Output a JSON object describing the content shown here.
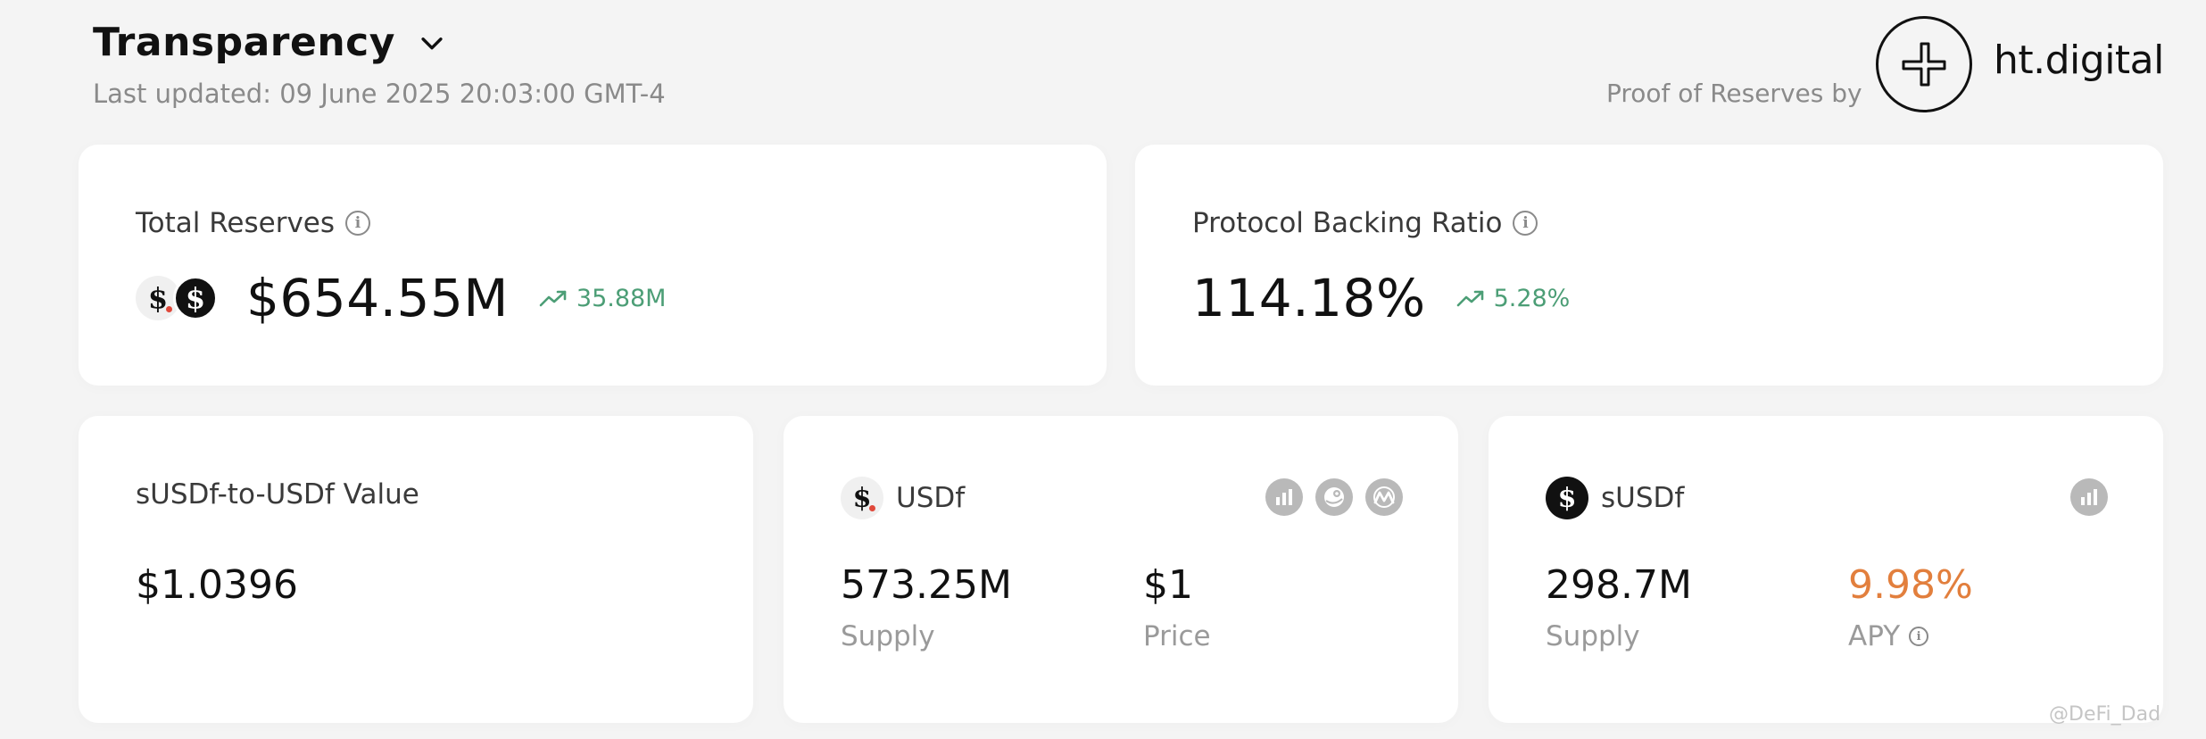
{
  "header": {
    "title": "Transparency",
    "last_updated": "Last updated: 09 June 2025 20:03:00 GMT-4",
    "por_label": "Proof of Reserves by",
    "brand_name": "ht.digital"
  },
  "total_reserves": {
    "label": "Total Reserves",
    "value": "$654.55M",
    "change": "35.88M"
  },
  "backing_ratio": {
    "label": "Protocol Backing Ratio",
    "value": "114.18%",
    "change": "5.28%"
  },
  "susdf_value": {
    "label": "sUSDf-to-USDf Value",
    "value": "$1.0396"
  },
  "usdf": {
    "name": "USDf",
    "supply_value": "573.25M",
    "supply_label": "Supply",
    "price_value": "$1",
    "price_label": "Price",
    "links": [
      "chart-icon",
      "gecko-icon",
      "coinmarketcap-icon"
    ]
  },
  "susdf": {
    "name": "sUSDf",
    "supply_value": "298.7M",
    "supply_label": "Supply",
    "apy_value": "9.98%",
    "apy_label": "APY",
    "links": [
      "chart-icon"
    ]
  },
  "watermark": "@DeFi_Dad",
  "colors": {
    "positive": "#4c9e76",
    "apy": "#e27f3d",
    "background": "#f4f4f4"
  }
}
